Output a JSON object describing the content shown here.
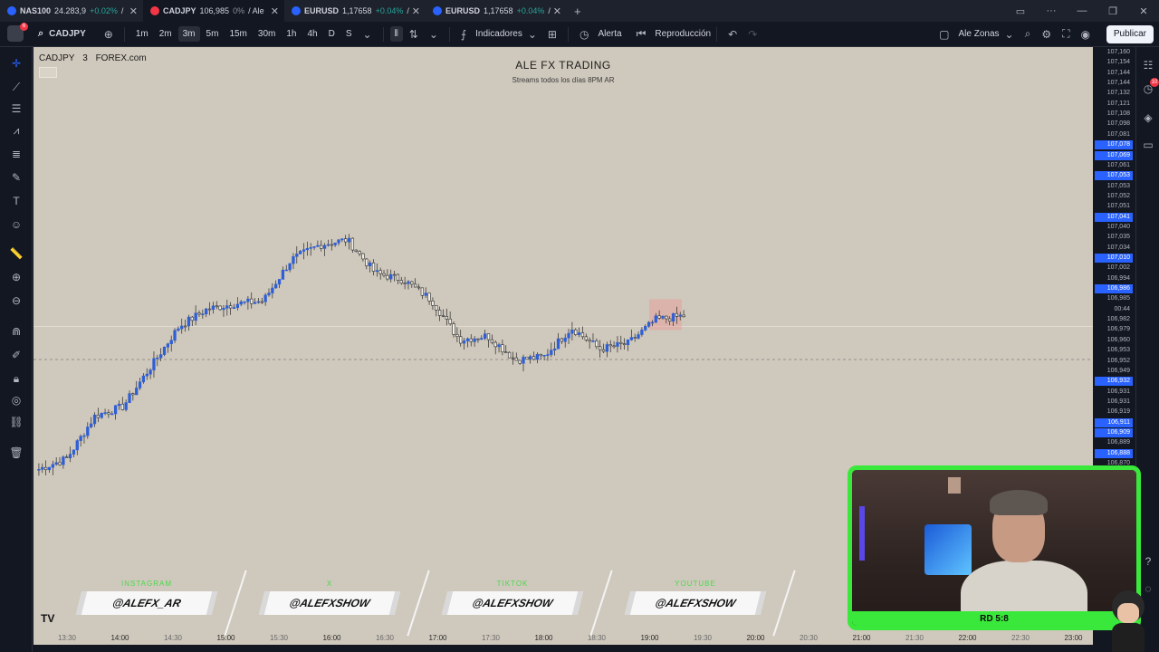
{
  "browser_tabs": [
    {
      "symbol": "NAS100",
      "price": "24.283,9",
      "change": "+0.02%",
      "suffix": "/",
      "favicon_color": "#2962ff",
      "change_color": "#26a69a",
      "active": false
    },
    {
      "symbol": "CADJPY",
      "price": "106,985",
      "change": "0%",
      "suffix": "/ Ale",
      "favicon_color": "#f23645",
      "change_color": "#8a8f98",
      "active": true
    },
    {
      "symbol": "EURUSD",
      "price": "1,17658",
      "change": "+0.04%",
      "suffix": "/",
      "favicon_color": "#2962ff",
      "change_color": "#26a69a",
      "active": false
    },
    {
      "symbol": "EURUSD",
      "price": "1,17658",
      "change": "+0.04%",
      "suffix": "/",
      "favicon_color": "#2962ff",
      "change_color": "#26a69a",
      "active": false
    }
  ],
  "toolbar": {
    "avatar_badge": "6",
    "symbol": "CADJPY",
    "intervals": [
      "1m",
      "2m",
      "3m",
      "5m",
      "15m",
      "30m",
      "1h",
      "4h",
      "D",
      "S"
    ],
    "active_interval": "3m",
    "indicators_label": "Indicadores",
    "alert_label": "Alerta",
    "replay_label": "Reproducción",
    "layout_label": "Ale Zonas",
    "publish_label": "Publicar"
  },
  "chart_header": {
    "symbol": "CADJPY",
    "interval": "3",
    "exchange": "FOREX.com",
    "title": "ALE FX TRADING",
    "subtitle": "Streams todos los días 8PM AR"
  },
  "price_axis": [
    {
      "value": "107,160",
      "highlight": false
    },
    {
      "value": "107,154",
      "highlight": false
    },
    {
      "value": "107,144",
      "highlight": false
    },
    {
      "value": "107,144",
      "highlight": false
    },
    {
      "value": "107,132",
      "highlight": false
    },
    {
      "value": "107,121",
      "highlight": false
    },
    {
      "value": "107,108",
      "highlight": false
    },
    {
      "value": "107,098",
      "highlight": false
    },
    {
      "value": "107,081",
      "highlight": false
    },
    {
      "value": "107,078",
      "highlight": true
    },
    {
      "value": "107,069",
      "highlight": true
    },
    {
      "value": "107,061",
      "highlight": false
    },
    {
      "value": "107,053",
      "highlight": true
    },
    {
      "value": "107,053",
      "highlight": false
    },
    {
      "value": "107,052",
      "highlight": false
    },
    {
      "value": "107,051",
      "highlight": false
    },
    {
      "value": "107,041",
      "highlight": true
    },
    {
      "value": "107,040",
      "highlight": false
    },
    {
      "value": "107,035",
      "highlight": false
    },
    {
      "value": "107,034",
      "highlight": false
    },
    {
      "value": "107,010",
      "highlight": true
    },
    {
      "value": "107,002",
      "highlight": false
    },
    {
      "value": "106,994",
      "highlight": false
    },
    {
      "value": "106,986",
      "highlight": true
    },
    {
      "value": "106,985",
      "highlight": false
    },
    {
      "value": "00:44",
      "highlight": false
    },
    {
      "value": "106,982",
      "highlight": false
    },
    {
      "value": "106,979",
      "highlight": false
    },
    {
      "value": "106,960",
      "highlight": false
    },
    {
      "value": "106,953",
      "highlight": false
    },
    {
      "value": "106,952",
      "highlight": false
    },
    {
      "value": "106,949",
      "highlight": false
    },
    {
      "value": "106,932",
      "highlight": true
    },
    {
      "value": "106,931",
      "highlight": false
    },
    {
      "value": "106,931",
      "highlight": false
    },
    {
      "value": "106,919",
      "highlight": false
    },
    {
      "value": "106,911",
      "highlight": true
    },
    {
      "value": "106,909",
      "highlight": true
    },
    {
      "value": "106,889",
      "highlight": false
    },
    {
      "value": "106,888",
      "highlight": true
    },
    {
      "value": "106,870",
      "highlight": false
    }
  ],
  "time_axis": [
    {
      "label": "13:30",
      "dim": true
    },
    {
      "label": "14:00",
      "dim": false
    },
    {
      "label": "14:30",
      "dim": true
    },
    {
      "label": "15:00",
      "dim": false
    },
    {
      "label": "15:30",
      "dim": true
    },
    {
      "label": "16:00",
      "dim": false
    },
    {
      "label": "16:30",
      "dim": true
    },
    {
      "label": "17:00",
      "dim": false
    },
    {
      "label": "17:30",
      "dim": true
    },
    {
      "label": "18:00",
      "dim": false
    },
    {
      "label": "18:30",
      "dim": true
    },
    {
      "label": "19:00",
      "dim": false
    },
    {
      "label": "19:30",
      "dim": true
    },
    {
      "label": "20:00",
      "dim": false
    },
    {
      "label": "20:30",
      "dim": true
    },
    {
      "label": "21:00",
      "dim": false
    },
    {
      "label": "21:30",
      "dim": true
    },
    {
      "label": "22:00",
      "dim": false
    },
    {
      "label": "22:30",
      "dim": true
    },
    {
      "label": "23:00",
      "dim": false
    }
  ],
  "social": [
    {
      "platform": "INSTAGRAM",
      "handle": "@ALEFX_AR"
    },
    {
      "platform": "X",
      "handle": "@ALEFXSHOW"
    },
    {
      "platform": "TIKTOK",
      "handle": "@ALEFXSHOW"
    },
    {
      "platform": "YOUTUBE",
      "handle": "@ALEFXSHOW"
    }
  ],
  "webcam": {
    "badge": "RD 5:8"
  },
  "right_sidebar": {
    "notification_count": "10"
  },
  "colors": {
    "chart_bg": "#cfc8bc",
    "candle_up": "#2e5fd6",
    "candle_down": "#2a2a2a",
    "accent": "#2962ff",
    "webcam_frame": "#39e83a"
  },
  "chart_data": {
    "type": "candlestick",
    "symbol": "CADJPY",
    "interval": "3m",
    "x_axis_labels": [
      "13:30",
      "14:00",
      "14:30",
      "15:00",
      "15:30",
      "16:00",
      "16:30",
      "17:00",
      "17:30",
      "18:00",
      "18:30",
      "19:00",
      "19:30",
      "20:00"
    ],
    "ylim": [
      106.87,
      107.16
    ],
    "current_price": 106.985,
    "close_path": [
      {
        "time": "13:30",
        "close": 106.878
      },
      {
        "time": "13:45",
        "close": 106.886
      },
      {
        "time": "14:00",
        "close": 106.918
      },
      {
        "time": "14:15",
        "close": 106.925
      },
      {
        "time": "14:30",
        "close": 106.955
      },
      {
        "time": "14:45",
        "close": 106.985
      },
      {
        "time": "15:00",
        "close": 106.998
      },
      {
        "time": "15:15",
        "close": 107.002
      },
      {
        "time": "15:30",
        "close": 107.004
      },
      {
        "time": "15:45",
        "close": 107.035
      },
      {
        "time": "16:00",
        "close": 107.046
      },
      {
        "time": "16:15",
        "close": 107.05
      },
      {
        "time": "16:30",
        "close": 107.025
      },
      {
        "time": "16:45",
        "close": 107.02
      },
      {
        "time": "17:00",
        "close": 107.005
      },
      {
        "time": "17:15",
        "close": 106.975
      },
      {
        "time": "17:30",
        "close": 106.978
      },
      {
        "time": "17:45",
        "close": 106.96
      },
      {
        "time": "18:00",
        "close": 106.962
      },
      {
        "time": "18:15",
        "close": 106.984
      },
      {
        "time": "18:30",
        "close": 106.968
      },
      {
        "time": "18:45",
        "close": 106.972
      },
      {
        "time": "19:00",
        "close": 106.99
      },
      {
        "time": "19:15",
        "close": 106.993
      }
    ]
  }
}
